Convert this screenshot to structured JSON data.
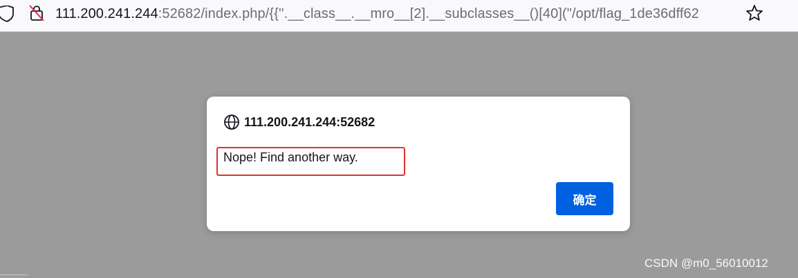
{
  "browser": {
    "url_host": "111.200.241.244",
    "url_rest": ":52682/index.php/{{''.__class__.__mro__[2].__subclasses__()[40](\"/opt/flag_1de36dff62",
    "icons": {
      "left_shield": "shield-icon",
      "site_info": "lock-slash-icon",
      "bookmark": "star-icon"
    }
  },
  "dialog": {
    "origin": "111.200.241.244:52682",
    "origin_icon": "globe-icon",
    "message": "Nope! Find another way.",
    "ok_label": "确定",
    "highlight_color": "#e03030",
    "button_color": "#0061e0"
  },
  "watermark": "CSDN @m0_56010012"
}
